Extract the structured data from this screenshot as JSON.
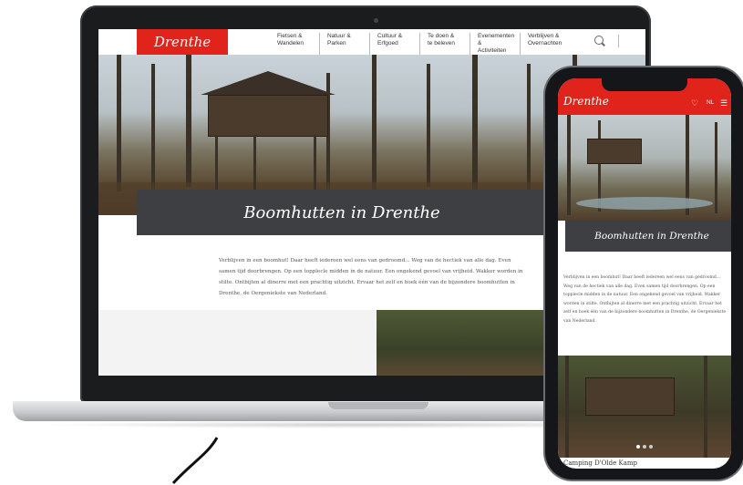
{
  "laptop": {
    "logo": "Drenthe",
    "nav": [
      "Fietsen &\nWandelen",
      "Natuur &\nParken",
      "Cultuur &\nErfgoed",
      "Te doen &\nte beleven",
      "Evenementen &\nActiviteiten",
      "Verblijven &\nOvernachten"
    ],
    "banner_title": "Boomhutten in Drenthe",
    "intro": "Verblijven in een boomhut! Daar heeft iedereen wel eens van gedroomd... Weg van de hectiek van alle dag. Even samen tijd doorbrengen. Op een topplecle midden in de natuur. Een ongekend gevoel van vrijheid. Wakker worden in stilte. Ontbijten al dinerre met een prachtig uitzicht. Ervaar het zelf en boek één van de bijzondere boomhutten in Drenthe, de Oergeniekste van Nederland."
  },
  "phone": {
    "logo": "Drenthe",
    "language": "NL",
    "banner_title": "Boomhutten in Drenthe",
    "intro": "Verblijven in een boomhut! Daar heeft iedereen wel eens van gedroomd... Weg van de hectiek van alle dag. Even samen tijd doorbrengen. Op een topplecle midden in de natuur. Een ongekend gevoel van vrijheid. Wakker worden in stilte. Ontbijten al dinerre met een prachtig uitzicht. Ervaar het zelf en boek één van de bijzondere boomhutten in Drenthe, de Oergeniekste van Nederland.",
    "caption": "Camping D'Olde Kamp",
    "carousel_dots": 3
  },
  "icons": [
    "search-icon",
    "heart-icon",
    "menu-icon"
  ],
  "colors": {
    "brand_red": "#e0231b",
    "banner_gray": "#3d3f42"
  }
}
